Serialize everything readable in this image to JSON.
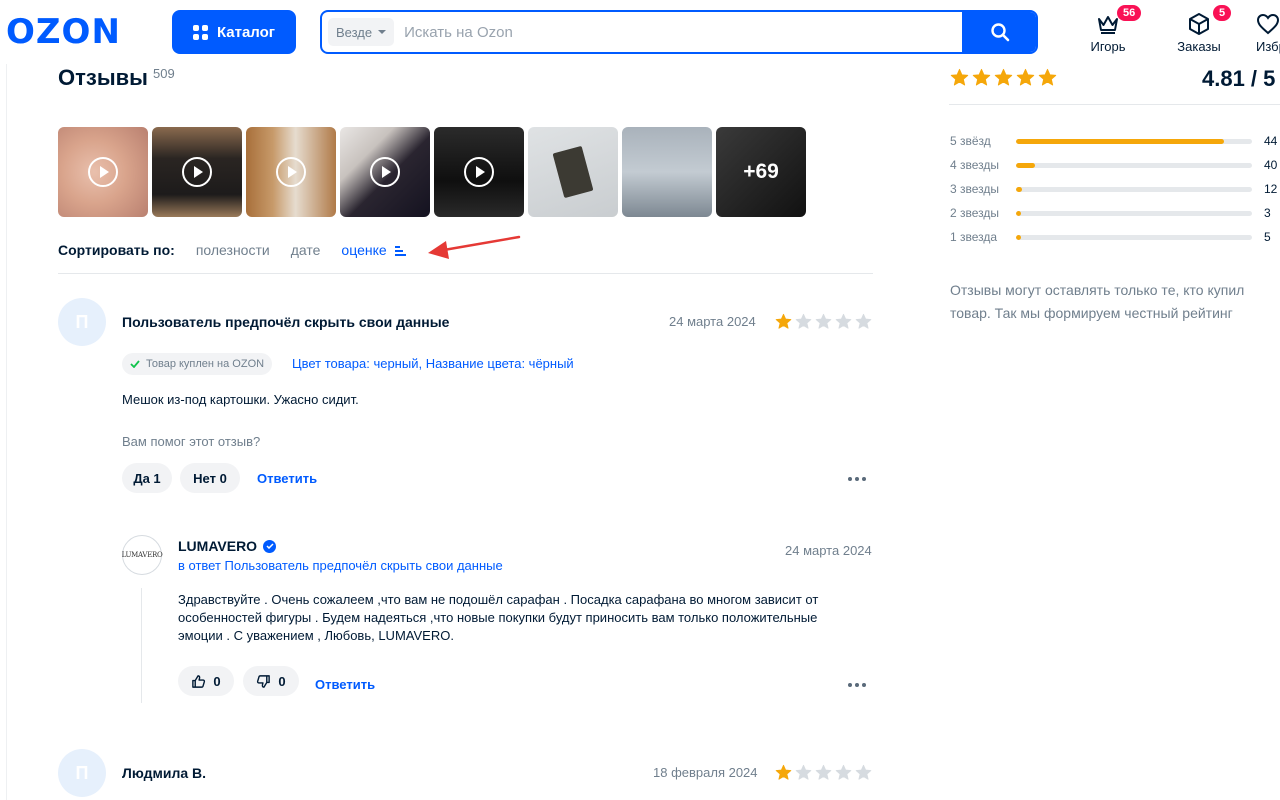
{
  "header": {
    "logo": "OZON",
    "catalog_label": "Каталог",
    "search_scope": "Везде",
    "search_placeholder": "Искать на Ozon",
    "nav": [
      {
        "label": "Игорь",
        "badge": "56",
        "icon": "crown-icon"
      },
      {
        "label": "Заказы",
        "badge": "5",
        "icon": "box-icon"
      },
      {
        "label": "Избранное",
        "icon": "heart-icon"
      }
    ]
  },
  "reviews": {
    "title": "Отзывы",
    "count": "509",
    "more_media": "+69",
    "sort": {
      "label": "Сортировать по:",
      "options": [
        "полезности",
        "дате",
        "оценке"
      ],
      "active": "оценке"
    },
    "items": [
      {
        "avatar": "П",
        "author": "Пользователь предпочёл скрыть свои данные",
        "date": "24 марта 2024",
        "rating": 1,
        "verified": "Товар куплен на OZON",
        "variant": "Цвет товара: черный, Название цвета: чёрный",
        "text": "Мешок из-под картошки. Ужасно сидит.",
        "helpful_question": "Вам помог этот отзыв?",
        "yes": "Да 1",
        "no": "Нет 0",
        "reply_label": "Ответить",
        "seller_reply": {
          "logo_text": "LUMAVERO",
          "seller": "LUMAVERO",
          "date": "24 марта 2024",
          "in_reply_to": "в ответ Пользователь предпочёл скрыть свои данные",
          "text_lines": [
            "Здравствуйте . Очень сожалеем ,что вам не подошёл сарафан . Посадка сарафана во многом зависит от",
            "особенностей фигуры . Будем надеяться ,что новые покупки будут приносить вам только положительные",
            "эмоции . С уважением , Любовь, LUMAVERO."
          ],
          "likes": "0",
          "dislikes": "0",
          "reply_label": "Ответить"
        }
      },
      {
        "avatar": "П",
        "author": "Людмила В.",
        "date": "18 февраля 2024",
        "rating": 1
      }
    ]
  },
  "summary": {
    "score": "4.81 / 5",
    "rows": [
      {
        "label": "5 звёзд",
        "value": "44",
        "fill": 0.88
      },
      {
        "label": "4 звезды",
        "value": "40",
        "fill": 0.08
      },
      {
        "label": "3 звезды",
        "value": "12",
        "fill": 0.025
      },
      {
        "label": "2 звезды",
        "value": "3",
        "fill": 0.008
      },
      {
        "label": "1 звезда",
        "value": "5",
        "fill": 0.01
      }
    ],
    "note_lines": [
      "Отзывы могут оставлять только те, кто купил",
      "товар. Так мы формируем честный рейтинг"
    ]
  },
  "colors": {
    "brand": "#005bff",
    "star": "#f5a70a",
    "badge": "#f91155",
    "annotation_arrow": "#e53935"
  }
}
